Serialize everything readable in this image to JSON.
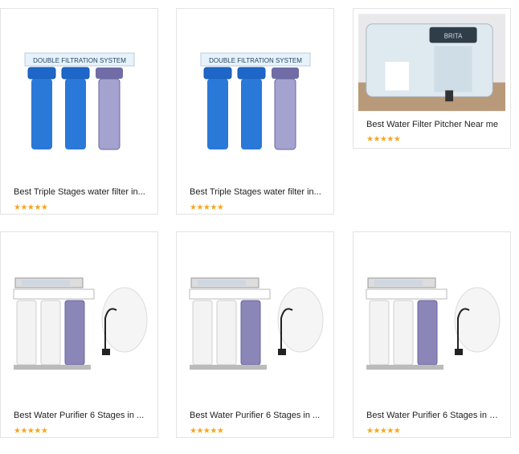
{
  "products": [
    {
      "title": "Best Triple Stages water filter in...",
      "image": "triple-stage-filter",
      "rating": 5
    },
    {
      "title": "Best Triple Stages water filter in...",
      "image": "triple-stage-filter",
      "rating": 5
    },
    {
      "title": "Best Water Filter Pitcher Near me",
      "image": "water-dispenser-pitcher",
      "rating": 5
    },
    {
      "title": "Best Water Purifier 6 Stages in ...",
      "image": "ro-purifier-6-stage",
      "rating": 5
    },
    {
      "title": "Best Water Purifier 6 Stages in ...",
      "image": "ro-purifier-6-stage",
      "rating": 5
    },
    {
      "title": "Best Water Purifier 6 Stages in J...",
      "image": "ro-purifier-6-stage",
      "rating": 5
    }
  ],
  "star_glyphs": "★★★★★",
  "colors": {
    "star": "#f5a623",
    "border": "#e3e3e3",
    "filter_blue": "#1e66c8",
    "filter_clear": "#8a86b8"
  }
}
